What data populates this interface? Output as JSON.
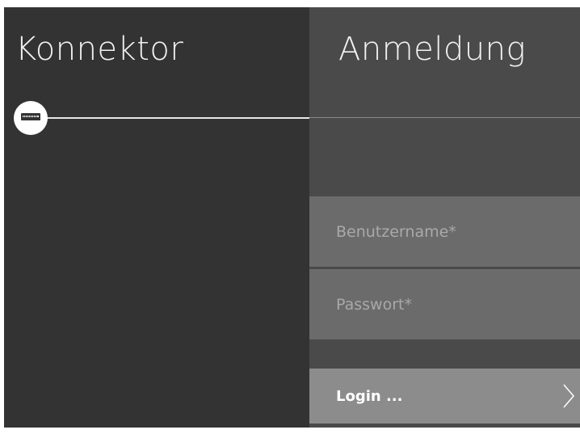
{
  "left": {
    "title": "Konnektor",
    "device_icon": "network-device-icon"
  },
  "right": {
    "title": "Anmeldung"
  },
  "form": {
    "username_placeholder": "Benutzername*",
    "password_placeholder": "Passwort*",
    "login_label": "Login ...",
    "login_icon": "chevron-right-icon"
  },
  "colors": {
    "left_bg": "#333333",
    "right_bg": "#4a4a4a",
    "field_bg": "#6b6b6b",
    "button_bg": "#8c8c8c",
    "text": "#f2f2f2"
  }
}
